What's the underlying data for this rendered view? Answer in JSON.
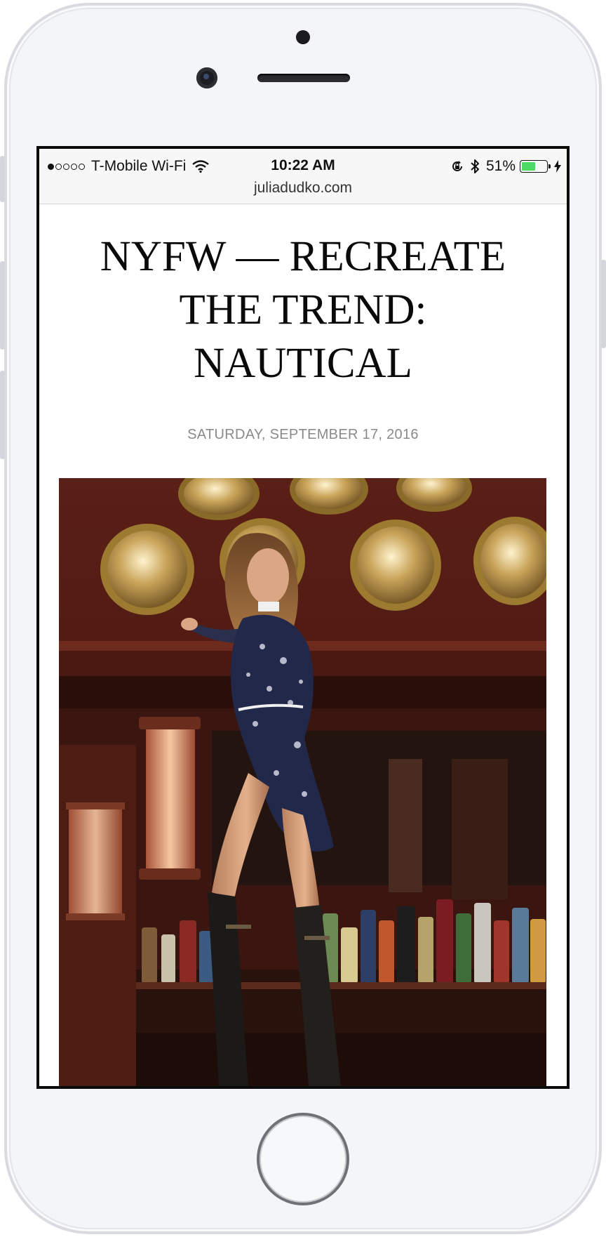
{
  "status_bar": {
    "carrier": "T-Mobile Wi-Fi",
    "time": "10:22 AM",
    "battery_percent": "51%",
    "battery_level": 0.51,
    "signal_bars": 1,
    "icons": [
      "wifi-icon",
      "orientation-lock-icon",
      "bluetooth-icon",
      "battery-icon",
      "charging-bolt-icon"
    ]
  },
  "browser": {
    "url": "juliadudko.com"
  },
  "post": {
    "title": "NYFW — RECREATE THE TREND: NAUTICAL",
    "date": "SATURDAY, SEPTEMBER 17, 2016"
  },
  "colors": {
    "accent_battery": "#4cd964",
    "title_text": "#0a0a0a",
    "date_text": "#8a8a8a"
  }
}
